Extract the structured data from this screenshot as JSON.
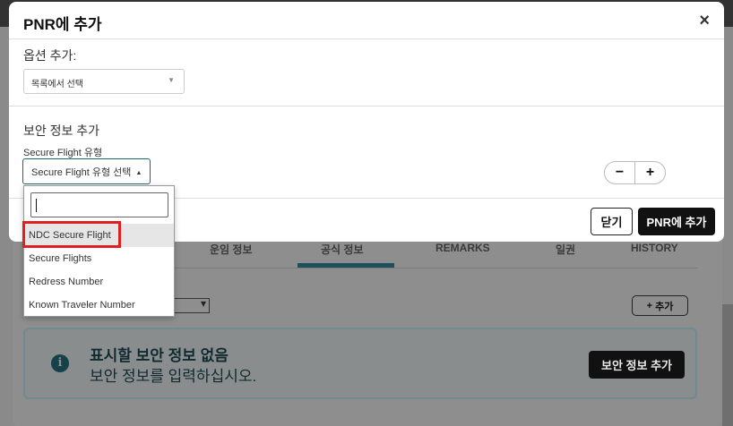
{
  "background": {
    "tabs": [
      "운임 정보",
      "공식 정보",
      "REMARKS",
      "일권",
      "HISTORY"
    ],
    "add_button_label": "추가",
    "info_title": "표시할 보안 정보 없음",
    "info_subtitle": "보안 정보를 입력하십시오.",
    "info_button_label": "보안 정보 추가"
  },
  "modal": {
    "title": "PNR에 추가",
    "close_symbol": "×",
    "options_label": "옵션 추가:",
    "options_select_value": "목록에서 선택",
    "security_section_title": "보안 정보 추가",
    "secure_flight_label": "Secure Flight 유형",
    "secure_flight_select_value": "Secure Flight 유형 선택",
    "stepper_minus": "−",
    "stepper_plus": "+",
    "close_button_label": "닫기",
    "add_button_label": "PNR에 추가"
  },
  "dropdown": {
    "search_value": "",
    "items": [
      {
        "label": "NDC Secure Flight",
        "highlighted": true
      },
      {
        "label": "Secure Flights",
        "highlighted": false
      },
      {
        "label": "Redress Number",
        "highlighted": false
      },
      {
        "label": "Known Traveler Number",
        "highlighted": false
      }
    ]
  },
  "colors": {
    "accent_border": "#1a6a74",
    "highlight_box": "#e02020",
    "primary_button": "#111111"
  }
}
